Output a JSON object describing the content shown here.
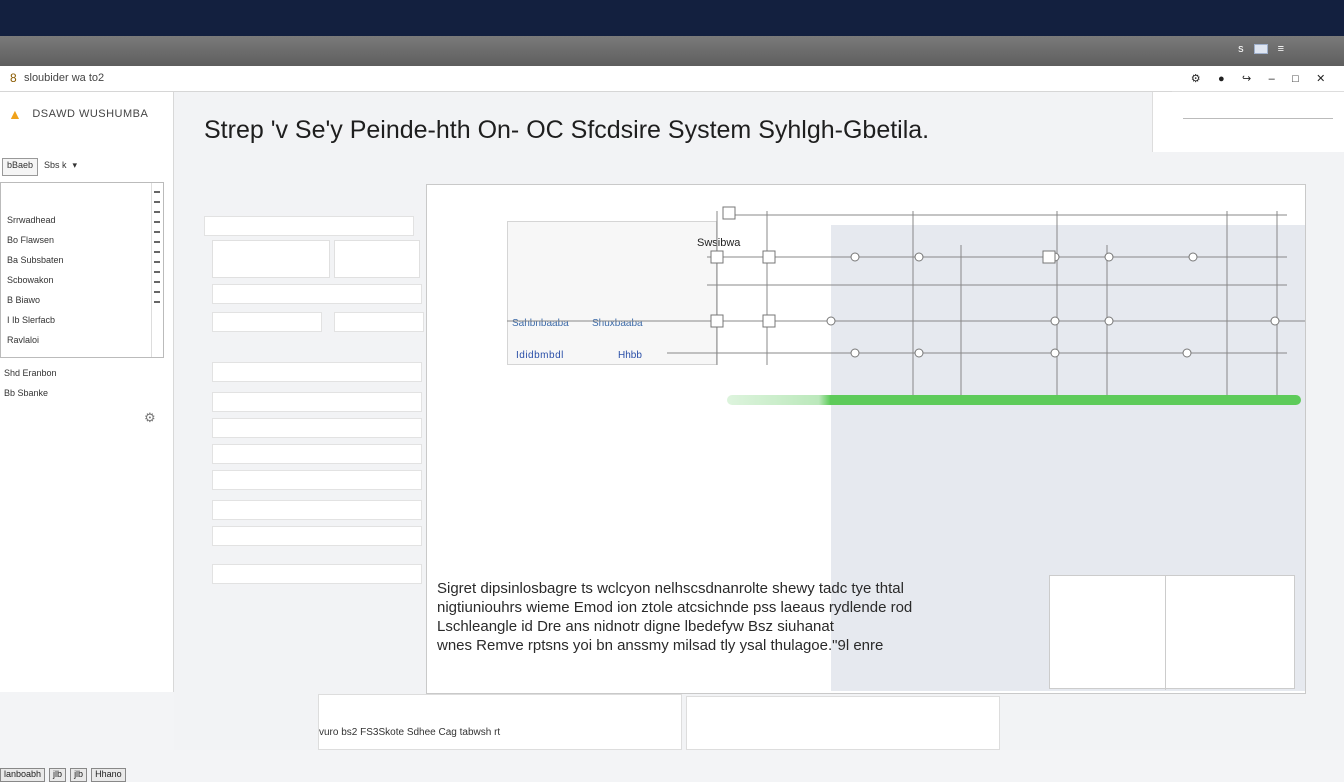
{
  "window": {
    "address_glyph": "8",
    "address_text": "sloubider wa to2"
  },
  "ribbon": {
    "tool_label": "s"
  },
  "sidebar": {
    "brand": "DSAWD WUSHUMBA",
    "filter_button": "bBaeb",
    "filter_select": "Sbs k",
    "tree_items": [
      "Srrwadhead",
      "Bo Flawsen",
      "Ba Subsbaten",
      "Scbowakon",
      "B Biawo",
      "I Ib Slerfacb",
      "Ravlaloi"
    ],
    "extra_items": [
      "Shd Eranbon",
      "Bb Sbanke"
    ],
    "bottom_tabs": [
      "lanboabh",
      "jlb",
      "jlb",
      "Hhano"
    ]
  },
  "main": {
    "title": "Strep 'v Se'y Peinde-hth On- OC Sfcdsire System Syhlgh-Gbetila.",
    "panel_label": "Swsibwa",
    "blue_labels": [
      "Ididbmbdl",
      "Hhbb",
      "Sahbnbaaba",
      "Shuxbaaba"
    ],
    "caption_lines": [
      "Sigret dipsinlosbagre ts wclcyon nelhscsdnanrolte shewy tadc tye thtal",
      "nigtiuniouhrs wieme Emod ion ztole atcsichnde pss laeaus rydlende rod",
      "Lschleangle id Dre ans nidnotr digne lbedefyw Bsz siuhanat",
      "wnes Remve rptsns yoi bn anssmy milsad tly ysal thulagoe.\"9l enre"
    ],
    "bottom_note": "vuro bs2 FS3Skote Sdhee Cag tabwsh rt"
  },
  "colors": {
    "topbar": "#13203f",
    "accent_green": "#5ecb5a",
    "accent_blue": "#2a4fa8"
  }
}
